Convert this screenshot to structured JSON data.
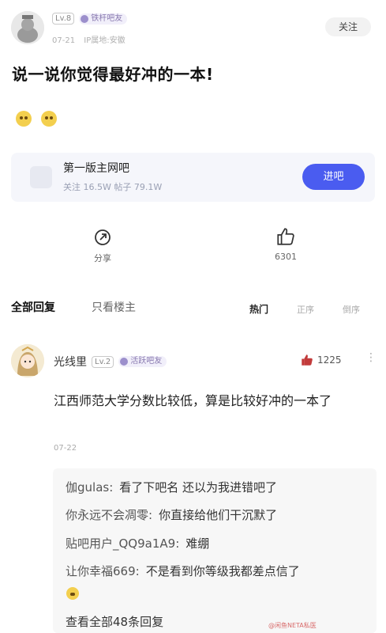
{
  "post": {
    "level": "Lv.8",
    "badge": "铁杆吧友",
    "date": "07-21",
    "ip": "IP属地:安徽",
    "follow_label": "关注",
    "title": "说一说你觉得最好冲的一本!"
  },
  "forum": {
    "name": "第一版主网吧",
    "stats": "关注 16.5W  帖子 79.1W",
    "enter_label": "进吧"
  },
  "actions": {
    "share_label": "分享",
    "like_count": "6301"
  },
  "tabs": {
    "all_replies": "全部回复",
    "only_op": "只看楼主",
    "sort_hot": "热门",
    "sort_asc": "正序",
    "sort_desc": "倒序"
  },
  "comment": {
    "user": "光线里",
    "level": "Lv.2",
    "badge": "活跃吧友",
    "likes": "1225",
    "text": "江西师范大学分数比较低，算是比较好冲的一本了",
    "date": "07-22",
    "replies": [
      {
        "user": "伽gulas:",
        "text": "看了下吧名 还以为我进错吧了"
      },
      {
        "user": "你永远不会凋零:",
        "text": "你直接给他们干沉默了"
      },
      {
        "user": "贴吧用户_QQ9a1A9:",
        "text": "难绷"
      },
      {
        "user": "让你幸福669:",
        "text": "不是看到你等级我都差点信了"
      }
    ],
    "more_replies": "查看全部48条回复"
  },
  "watermark": "@闲鱼NETA私医"
}
